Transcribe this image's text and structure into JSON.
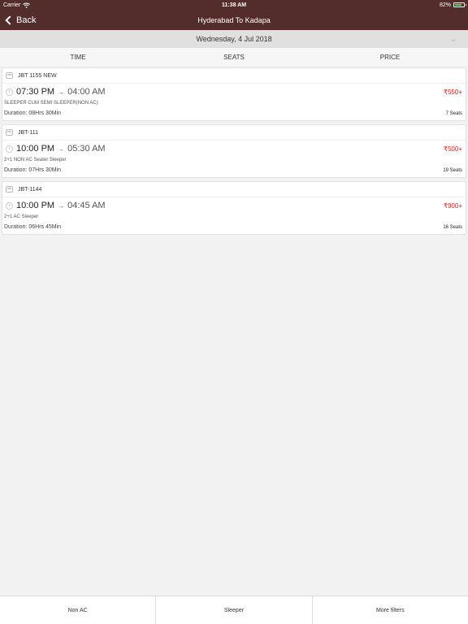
{
  "status_bar": {
    "carrier": "Carrier",
    "time": "11:38 AM",
    "battery": "82%",
    "battery_fill": 0.82,
    "wifi_icon": "wifi-icon",
    "battery_icon": "battery-icon"
  },
  "nav": {
    "back_label": "Back",
    "title": "Hyderabad To Kadapa"
  },
  "date_bar": {
    "date": "Wednesday, 4 Jul 2018",
    "next_icon": "arrow-right-icon",
    "next_glyph": "→"
  },
  "sort": {
    "time": "TIME",
    "seats": "SEATS",
    "price": "PRICE"
  },
  "buses": [
    {
      "name": "JBT 1155 NEW",
      "departure": "07:30 PM",
      "arrival": "04:00 AM",
      "type": "SLEEPER CUM SEMI SLEEPER(NON AC)",
      "duration": "Duration: 08Hrs 30Min",
      "price": "₹550+",
      "seats": "7 Seats"
    },
    {
      "name": "JBT-111",
      "departure": "10:00 PM",
      "arrival": "05:30 AM",
      "type": "2+1 NON AC Seater Sleeper",
      "duration": "Duration: 07Hrs 30Min",
      "price": "₹500+",
      "seats": "19 Seats"
    },
    {
      "name": "JBT-1144",
      "departure": "10:00 PM",
      "arrival": "04:45 AM",
      "type": "2+1 AC Sleeper",
      "duration": "Duration: 06Hrs 45Min",
      "price": "₹900+",
      "seats": "16 Seats"
    }
  ],
  "arrow_glyph": "→",
  "filters": {
    "non_ac": "Non AC",
    "sleeper": "Sleeper",
    "more": "More filters"
  },
  "colors": {
    "header_bg": "#532c2c",
    "price": "#e0211b",
    "battery": "#4cd964"
  }
}
